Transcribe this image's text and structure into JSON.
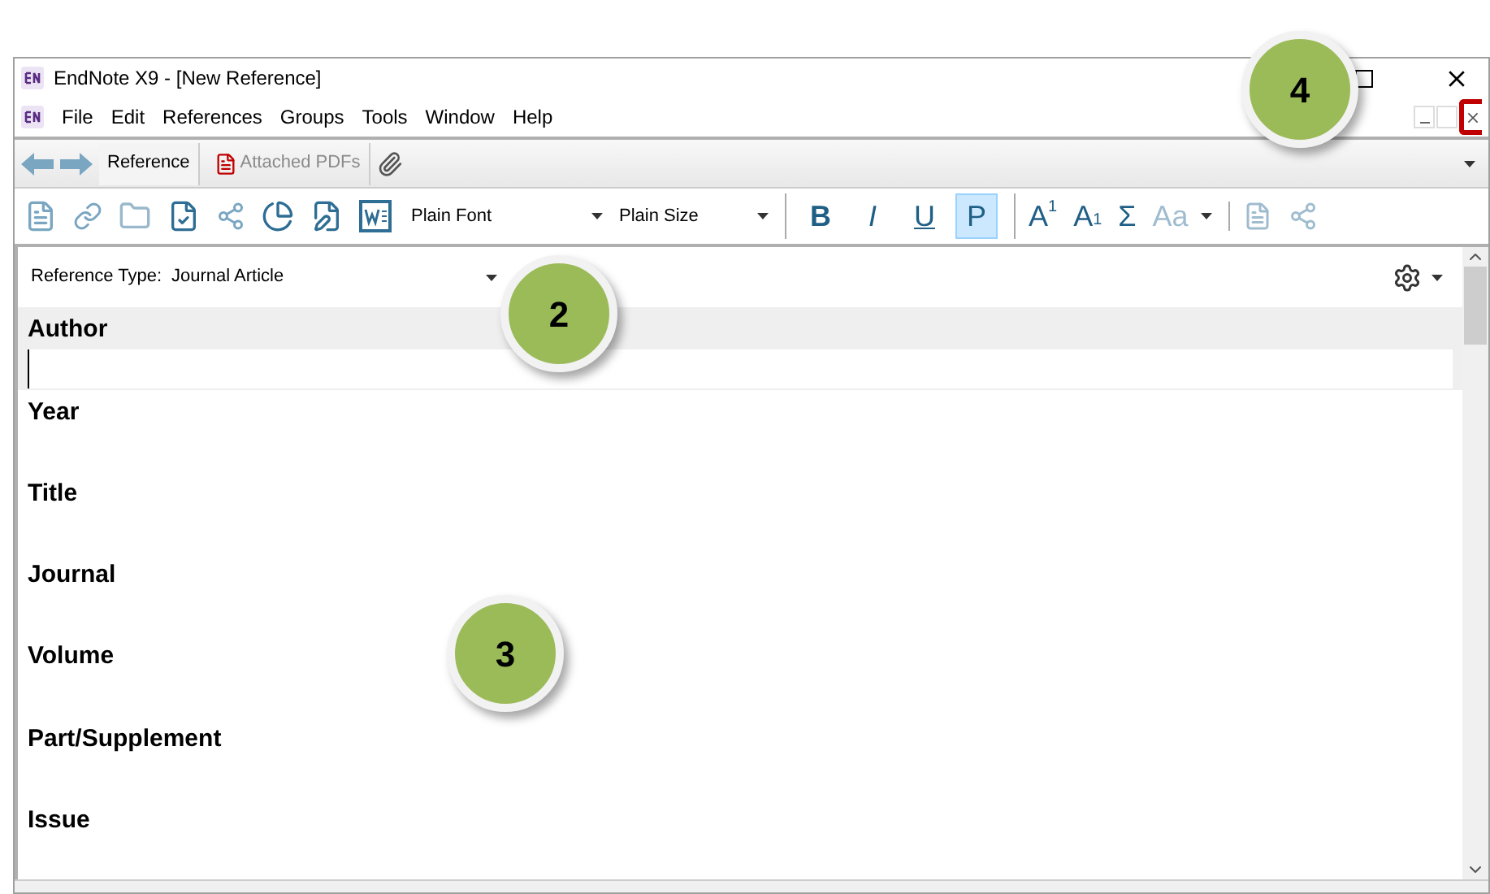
{
  "window": {
    "title": "EndNote X9 - [New Reference]"
  },
  "menu": [
    "File",
    "Edit",
    "References",
    "Groups",
    "Tools",
    "Window",
    "Help"
  ],
  "tabs": [
    {
      "label": "Reference",
      "selected": true
    },
    {
      "label": "Attached PDFs",
      "selected": false
    }
  ],
  "toolbar": {
    "font": "Plain Font",
    "size": "Plain Size",
    "format_buttons": [
      {
        "label": "B",
        "kind": "bold",
        "selected": false
      },
      {
        "label": "I",
        "kind": "italic",
        "selected": false
      },
      {
        "label": "U",
        "kind": "underline",
        "selected": false
      },
      {
        "label": "P",
        "kind": "plain",
        "selected": true
      }
    ],
    "script_buttons": [
      {
        "label": "A",
        "sub": "1",
        "kind": "superscript",
        "disabled": false
      },
      {
        "label": "A",
        "sub": "1",
        "kind": "subscript",
        "disabled": false
      },
      {
        "label": "Σ",
        "kind": "symbol",
        "disabled": false
      },
      {
        "label": "Aa",
        "kind": "case",
        "disabled": true
      }
    ]
  },
  "reference_type": {
    "label": "Reference Type:",
    "value": "Journal Article"
  },
  "fields": [
    {
      "label": "Author",
      "selected": true
    },
    {
      "label": "Year",
      "selected": false
    },
    {
      "label": "Title",
      "selected": false
    },
    {
      "label": "Journal",
      "selected": false
    },
    {
      "label": "Volume",
      "selected": false
    },
    {
      "label": "Part/Supplement",
      "selected": false
    },
    {
      "label": "Issue",
      "selected": false
    }
  ],
  "callouts": [
    {
      "number": "4",
      "kind": "window-controls"
    },
    {
      "number": "2",
      "kind": "reference-type"
    },
    {
      "number": "3",
      "kind": "fields"
    }
  ]
}
